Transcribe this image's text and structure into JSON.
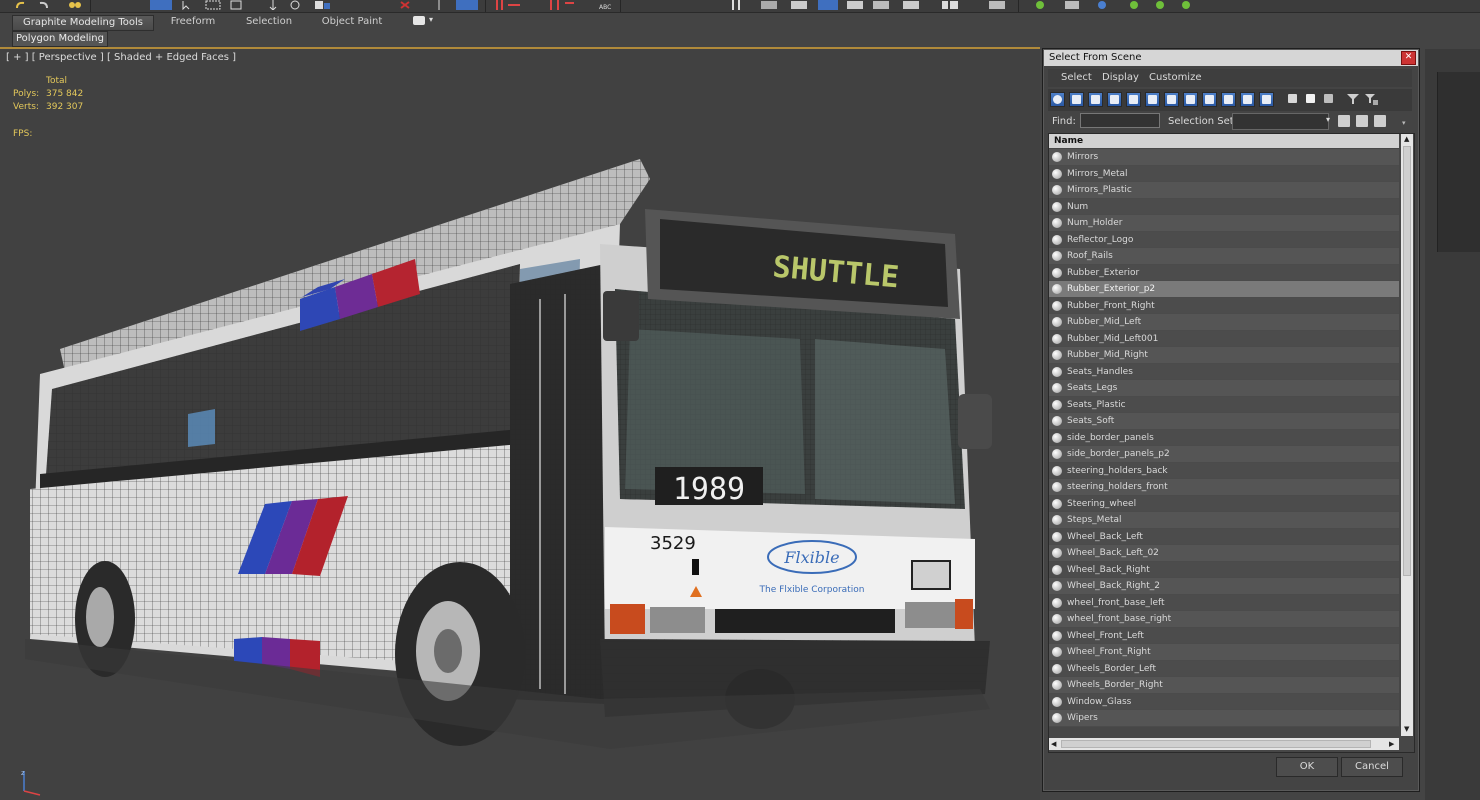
{
  "ribbon": {
    "tabs": [
      "Graphite Modeling Tools",
      "Freeform",
      "Selection",
      "Object Paint"
    ],
    "panel_label": "Polygon Modeling"
  },
  "viewport": {
    "label": "[ + ] [ Perspective ] [ Shaded + Edged Faces ]",
    "stats": {
      "total_label": "Total",
      "polys_label": "Polys:",
      "polys_value": "375 842",
      "verts_label": "Verts:",
      "verts_value": "392 307",
      "fps_label": "FPS:"
    },
    "bus_texts": {
      "destination_sign": "SHUTTLE",
      "year_plate": "1989",
      "fleet_number": "3529",
      "logo": "Flxible",
      "corporation": "The Flxible Corporation"
    }
  },
  "dialog": {
    "title": "Select From Scene",
    "close_glyph": "✕",
    "menu": [
      "Select",
      "Display",
      "Customize"
    ],
    "find_label": "Find:",
    "find_value": "",
    "selection_set_label": "Selection Set:",
    "list_header": "Name",
    "items": [
      "Mirrors",
      "Mirrors_Metal",
      "Mirrors_Plastic",
      "Num",
      "Num_Holder",
      "Reflector_Logo",
      "Roof_Rails",
      "Rubber_Exterior",
      "Rubber_Exterior_p2",
      "Rubber_Front_Right",
      "Rubber_Mid_Left",
      "Rubber_Mid_Left001",
      "Rubber_Mid_Right",
      "Seats_Handles",
      "Seats_Legs",
      "Seats_Plastic",
      "Seats_Soft",
      "side_border_panels",
      "side_border_panels_p2",
      "steering_holders_back",
      "steering_holders_front",
      "Steering_wheel",
      "Steps_Metal",
      "Wheel_Back_Left",
      "Wheel_Back_Left_02",
      "Wheel_Back_Right",
      "Wheel_Back_Right_2",
      "wheel_front_base_left",
      "wheel_front_base_right",
      "Wheel_Front_Left",
      "Wheel_Front_Right",
      "Wheels_Border_Left",
      "Wheels_Border_Right",
      "Window_Glass",
      "Wipers"
    ],
    "selected_index": 8,
    "ok_label": "OK",
    "cancel_label": "Cancel"
  },
  "colors": {
    "stats_text": "#e3c85b",
    "selection_highlight": "#7a7a7a",
    "accent_blue": "#3a6cb8"
  }
}
